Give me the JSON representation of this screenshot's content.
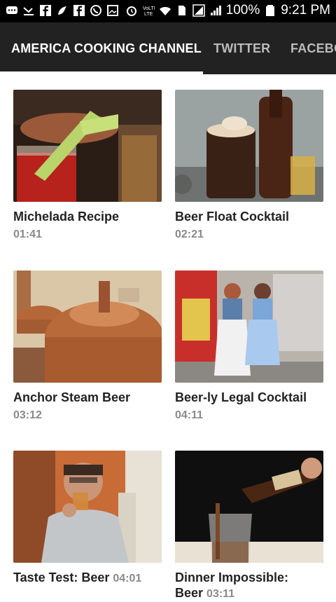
{
  "status_bar": {
    "battery": "100%",
    "time": "9:21 PM"
  },
  "tabs": [
    {
      "label": "AMERICA COOKING CHANNEL"
    },
    {
      "label": "TWITTER"
    },
    {
      "label": "FACEBO"
    }
  ],
  "videos": [
    {
      "title": "Michelada Recipe",
      "duration": "01:41"
    },
    {
      "title": "Beer Float Cocktail",
      "duration": "02:21"
    },
    {
      "title": "Anchor Steam Beer",
      "duration": "03:12"
    },
    {
      "title": "Beer-ly Legal Cocktail",
      "duration": "04:11"
    },
    {
      "title": "Taste Test: Beer",
      "duration": "04:01"
    },
    {
      "title": "Dinner Impossible:",
      "title2": "Beer",
      "duration": "03:11"
    }
  ]
}
